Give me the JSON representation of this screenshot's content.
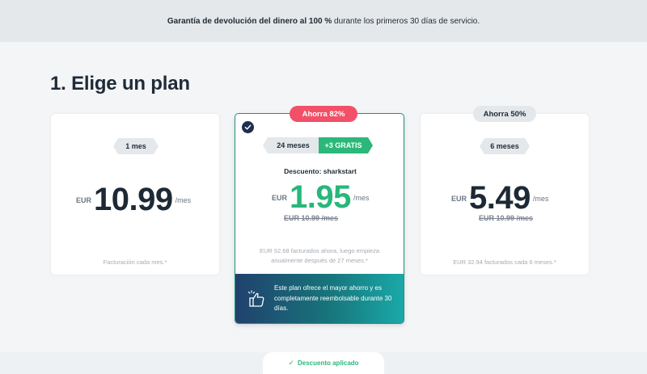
{
  "banner": {
    "bold": "Garantía de devolución del dinero al 100 %",
    "rest": " durante los primeros 30 días de servicio."
  },
  "page_title": "1. Elige un plan",
  "plans": [
    {
      "label": "1 mes",
      "currency": "EUR",
      "price": "10.99",
      "per": "/mes",
      "note": "Facturación cada mes.*"
    },
    {
      "badge": "Ahorra 82%",
      "label": "24 meses",
      "bonus": "+3 GRATIS",
      "discount": "Descuento: sharkstart",
      "currency": "EUR",
      "price": "1.95",
      "per": "/mes",
      "old_price": "EUR 10.99 /mes",
      "note": "EUR 52.68 facturados ahora, luego empieza anualmente después de 27 meses.*",
      "promo": "Este plan ofrece el mayor ahorro y es completamente reembolsable durante 30 días.",
      "selected": true
    },
    {
      "badge": "Ahorra 50%",
      "label": "6 meses",
      "currency": "EUR",
      "price": "5.49",
      "per": "/mes",
      "old_price": "EUR 10.99 /mes",
      "note": "EUR 32.94 facturados cada 6 meses.*"
    }
  ],
  "bottom_tab": {
    "text": "Descuento aplicado"
  },
  "colors": {
    "accent_green": "#2bb87a",
    "badge_red": "#f25068",
    "selected_border": "#1f8f84",
    "dark_navy": "#1e2e4f"
  },
  "icons": {
    "check": "check-icon",
    "promo": "thumbs-up-icon",
    "tick": "tick-icon"
  }
}
